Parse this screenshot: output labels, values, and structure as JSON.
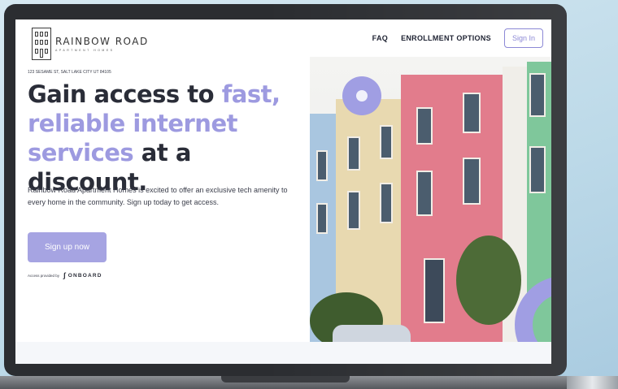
{
  "logo": {
    "name": "RAINBOW ROAD",
    "sub": "APARTMENT HOMES"
  },
  "nav": {
    "faq": "FAQ",
    "enrollment": "ENROLLMENT OPTIONS",
    "signin": "Sign In"
  },
  "hero": {
    "address": "123 SESAME ST, SALT LAKE CITY UT 84105",
    "headline_part1": "Gain access to ",
    "headline_accent": "fast, reliable internet services",
    "headline_part2": " at a discount.",
    "description": "Rainbow Road Apartment Homes is excited to offer an exclusive tech amenity to every home in the community. Sign up today to get access.",
    "cta": "Sign up now",
    "provided_by": "Access provided by",
    "provider": "ONBOARD"
  },
  "colors": {
    "accent": "#9d9ae0",
    "heading": "#2a2d38",
    "button": "#a6a4e2"
  }
}
